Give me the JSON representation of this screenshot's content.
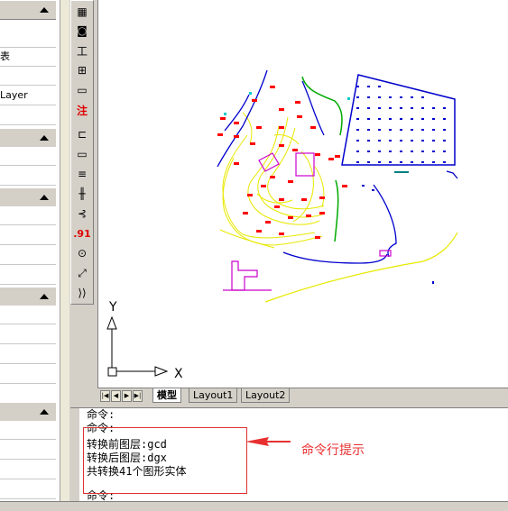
{
  "left_panel": {
    "rows": [
      "",
      "",
      "表",
      "",
      "Layer",
      "",
      "",
      "",
      "",
      "",
      "",
      "",
      "",
      "",
      "",
      "",
      "",
      ""
    ]
  },
  "toolbar": {
    "tools": [
      {
        "name": "grid-icon",
        "glyph": "▦"
      },
      {
        "name": "camera-icon",
        "glyph": "◙"
      },
      {
        "name": "ruler-icon",
        "glyph": "工"
      },
      {
        "name": "xy-coord-icon",
        "glyph": "⊞"
      },
      {
        "name": "search-area-icon",
        "glyph": "▭"
      },
      {
        "name": "annotation-icon",
        "glyph": "注"
      },
      {
        "name": "polyline-icon",
        "glyph": "⊏"
      },
      {
        "name": "rectangle-icon",
        "glyph": "▭"
      },
      {
        "name": "hatch-icon",
        "glyph": "≡"
      },
      {
        "name": "fence-icon",
        "glyph": "╫"
      },
      {
        "name": "road-icon",
        "glyph": "⊰"
      },
      {
        "name": "decimal-icon",
        "glyph": ".91"
      },
      {
        "name": "circle-point-icon",
        "glyph": "⊙"
      },
      {
        "name": "measure-icon",
        "glyph": "⤢"
      },
      {
        "name": "curve-icon",
        "glyph": "⟩⟩"
      }
    ]
  },
  "ucs": {
    "x_label": "X",
    "y_label": "Y"
  },
  "layout_tabs": [
    {
      "label": "模型",
      "active": true
    },
    {
      "label": "Layout1",
      "active": false
    },
    {
      "label": "Layout2",
      "active": false
    }
  ],
  "command_lines": [
    "命令:",
    "命令:",
    "转换前图层:gcd",
    "转换后图层:dgx",
    "共转换41个图形实体",
    "",
    "命令:"
  ],
  "annotation": {
    "label": "命令行提示",
    "color": "#e83030"
  },
  "colors": {
    "contour": "#e8e800",
    "boundary": "#0000cc",
    "building": "#cc00cc",
    "marker": "#ff0000",
    "green": "#00aa00",
    "cyan": "#00cccc"
  }
}
